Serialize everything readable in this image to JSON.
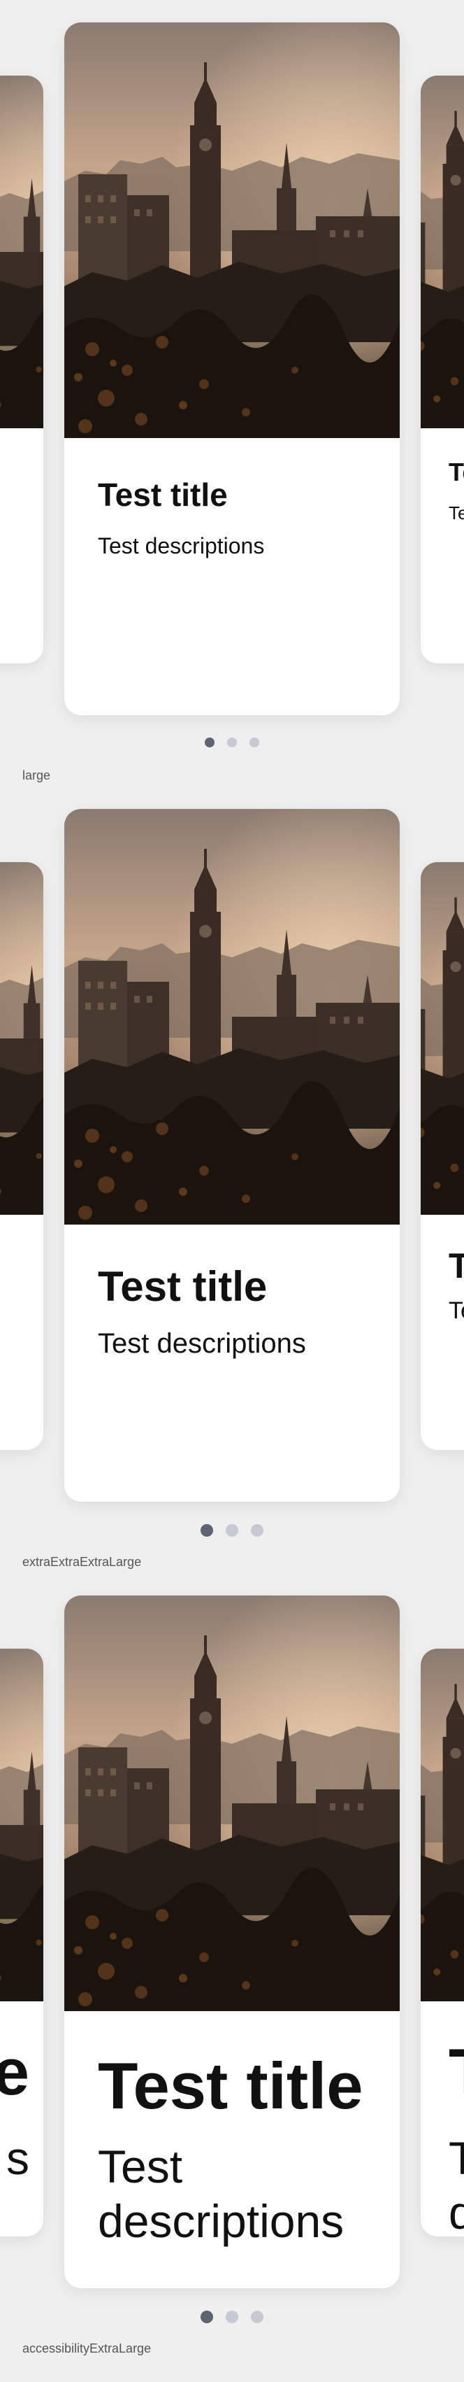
{
  "sections": [
    {
      "size_label": "large",
      "card": {
        "title": "Test title",
        "description": "Test descriptions"
      },
      "peek_left": {
        "title": "",
        "description": ""
      },
      "peek_right": {
        "title": "Te",
        "description": "Te"
      },
      "pagination": {
        "count": 3,
        "active_index": 0
      }
    },
    {
      "size_label": "extraExtraExtraLarge",
      "card": {
        "title": "Test title",
        "description": "Test descriptions"
      },
      "peek_left": {
        "title": "",
        "description": ""
      },
      "peek_right": {
        "title": "T",
        "description": "Te"
      },
      "pagination": {
        "count": 3,
        "active_index": 0
      }
    },
    {
      "size_label": "accessibilityExtraLarge",
      "card": {
        "title": "Test title",
        "description": "Test descriptions"
      },
      "peek_left": {
        "title": "e",
        "description": "s"
      },
      "peek_right": {
        "title": "T",
        "description": "T d"
      },
      "pagination": {
        "count": 3,
        "active_index": 0
      }
    }
  ],
  "image": {
    "name": "city-skyline-photo",
    "sky_color": "#c9a88a",
    "ground_color": "#201812"
  },
  "colors": {
    "dot_active": "#5b6470",
    "dot_inactive": "#c6c9cf",
    "background": "#efefef"
  }
}
